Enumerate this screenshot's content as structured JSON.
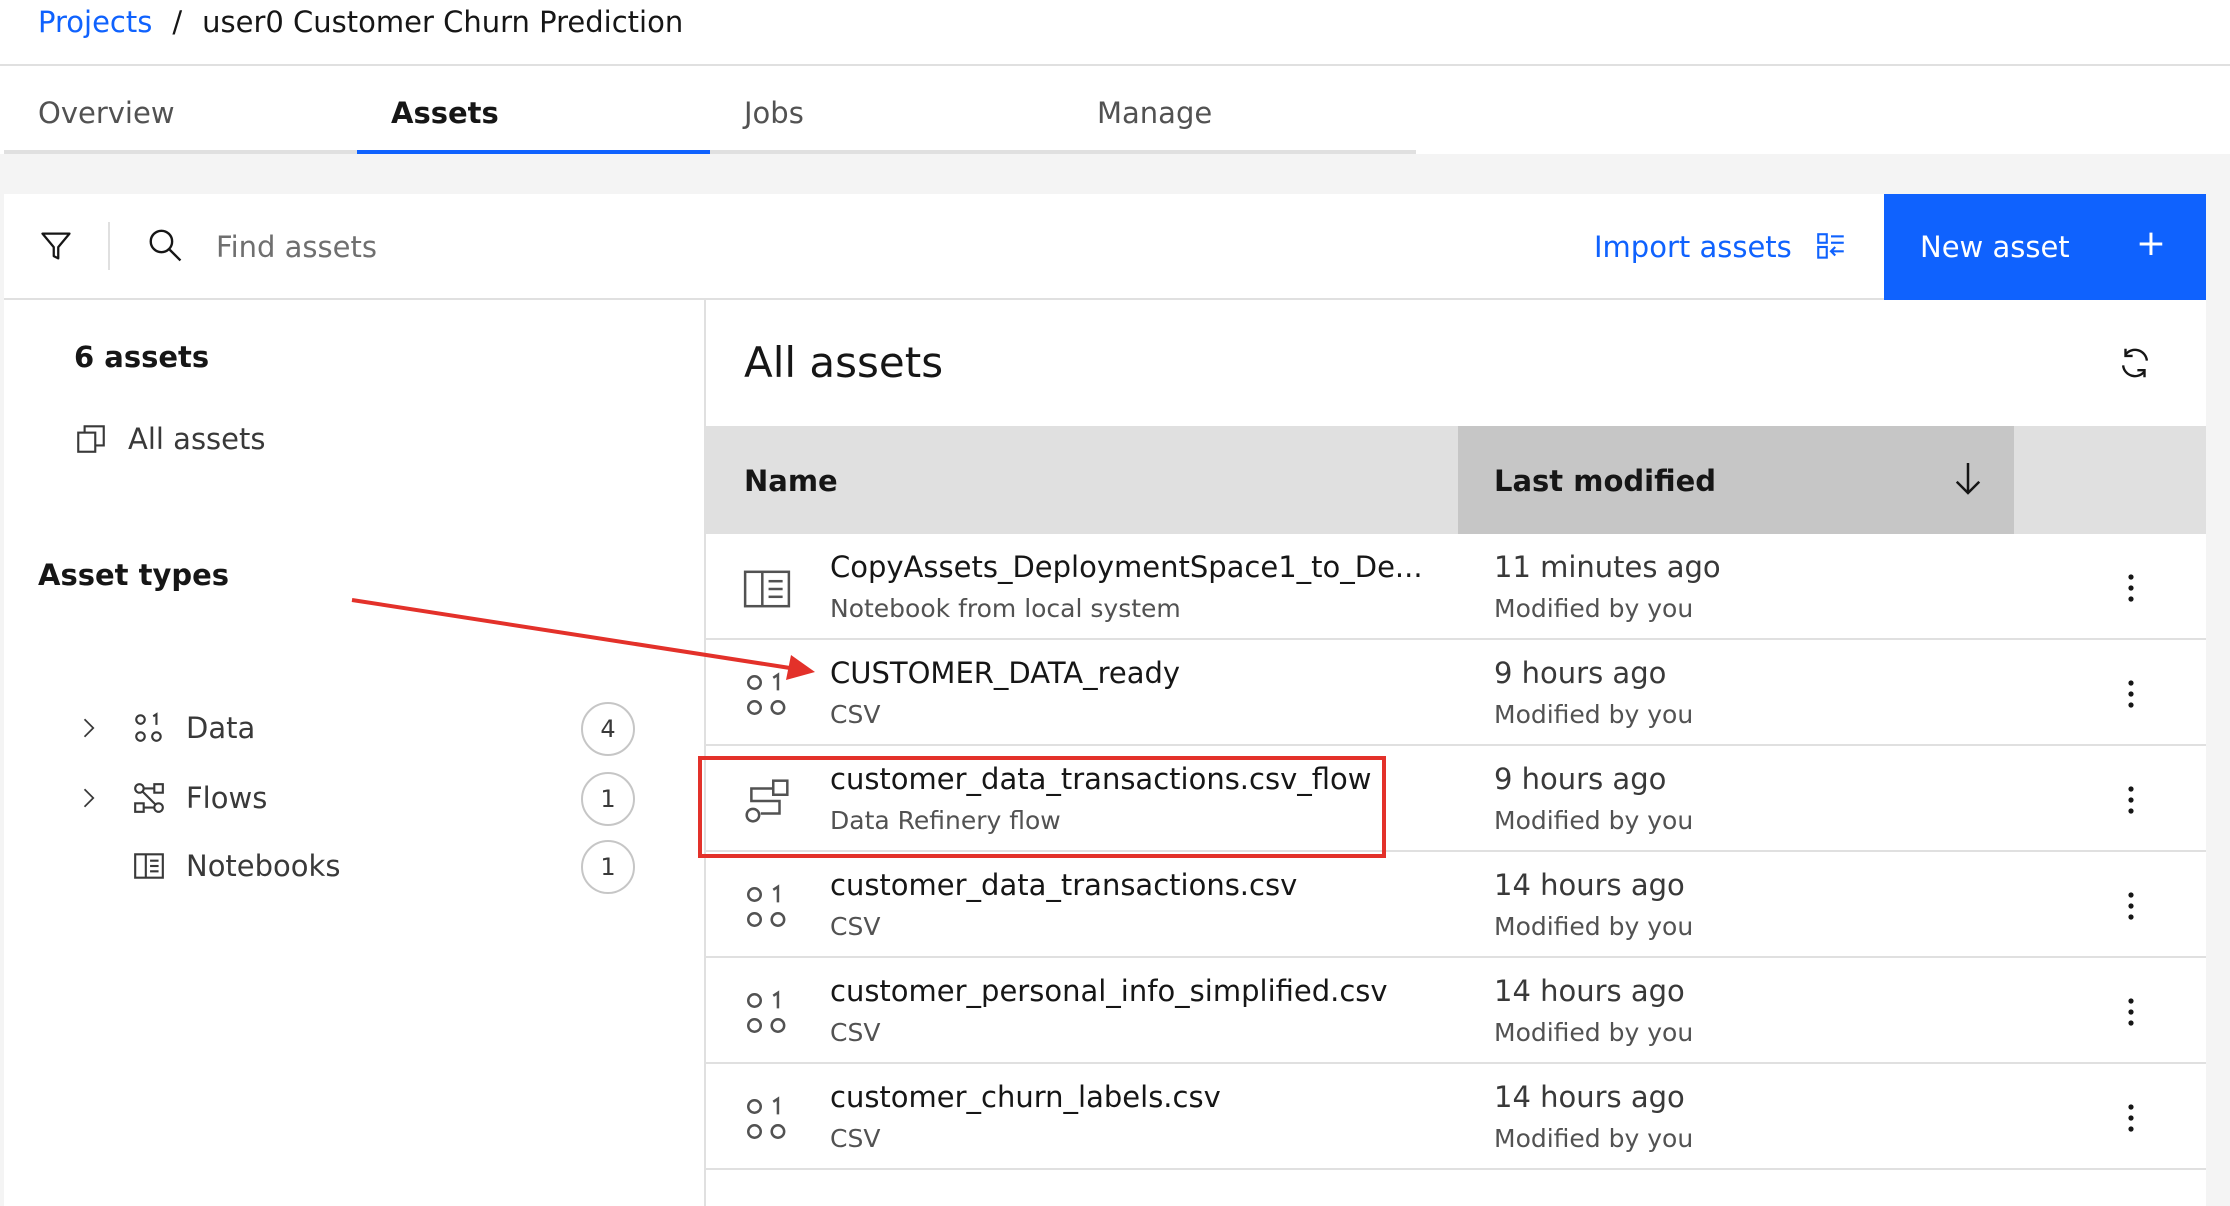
{
  "breadcrumb": {
    "projects_label": "Projects",
    "separator": "/",
    "current": "user0 Customer Churn Prediction"
  },
  "tabs": [
    {
      "label": "Overview",
      "active": false
    },
    {
      "label": "Assets",
      "active": true
    },
    {
      "label": "Jobs",
      "active": false
    },
    {
      "label": "Manage",
      "active": false
    }
  ],
  "toolbar": {
    "filter_icon": "filter-icon",
    "search_icon": "search-icon",
    "search_placeholder": "Find assets",
    "search_value": "",
    "import_label": "Import assets",
    "import_icon": "import-icon",
    "new_asset_label": "New asset",
    "new_asset_icon": "+"
  },
  "sidebar": {
    "count_label": "6 assets",
    "all_assets_label": "All assets",
    "asset_types_heading": "Asset types",
    "types": [
      {
        "label": "Data",
        "count": "4",
        "icon": "data-icon",
        "expandable": true
      },
      {
        "label": "Flows",
        "count": "1",
        "icon": "flows-icon",
        "expandable": true
      },
      {
        "label": "Notebooks",
        "count": "1",
        "icon": "notebook-icon",
        "expandable": false
      }
    ]
  },
  "main": {
    "title": "All assets",
    "columns": {
      "name": "Name",
      "last_modified": "Last modified"
    },
    "rows": [
      {
        "name": "CopyAssets_DeploymentSpace1_to_De...",
        "type": "Notebook from local system",
        "time": "11 minutes ago",
        "by": "Modified by you",
        "icon": "notebook-icon"
      },
      {
        "name": "CUSTOMER_DATA_ready",
        "type": "CSV",
        "time": "9 hours ago",
        "by": "Modified by you",
        "icon": "data-icon"
      },
      {
        "name": "customer_data_transactions.csv_flow",
        "type": "Data Refinery flow",
        "time": "9 hours ago",
        "by": "Modified by you",
        "icon": "flow-icon"
      },
      {
        "name": "customer_data_transactions.csv",
        "type": "CSV",
        "time": "14 hours ago",
        "by": "Modified by you",
        "icon": "data-icon"
      },
      {
        "name": "customer_personal_info_simplified.csv",
        "type": "CSV",
        "time": "14 hours ago",
        "by": "Modified by you",
        "icon": "data-icon"
      },
      {
        "name": "customer_churn_labels.csv",
        "type": "CSV",
        "time": "14 hours ago",
        "by": "Modified by you",
        "icon": "data-icon"
      }
    ]
  },
  "colors": {
    "accent": "#0f62fe",
    "annotation": "#e3312a",
    "header_bg": "#e0e0e0",
    "sorted_header_bg": "#c6c6c6"
  }
}
